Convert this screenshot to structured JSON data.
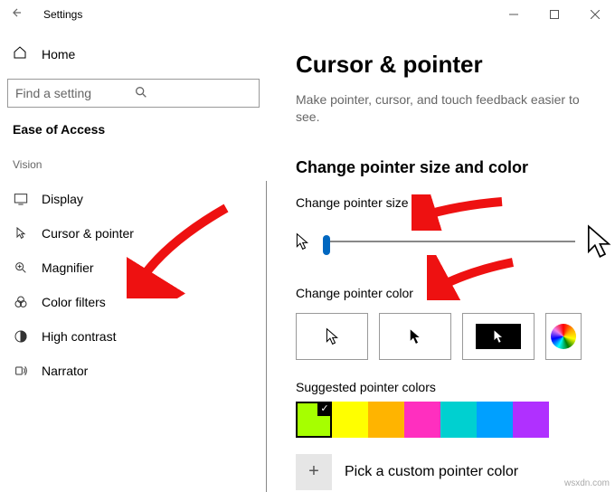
{
  "titlebar": {
    "title": "Settings"
  },
  "sidebar": {
    "home": "Home",
    "search_placeholder": "Find a setting",
    "category": "Ease of Access",
    "group": "Vision",
    "items": [
      {
        "label": "Display"
      },
      {
        "label": "Cursor & pointer"
      },
      {
        "label": "Magnifier"
      },
      {
        "label": "Color filters"
      },
      {
        "label": "High contrast"
      },
      {
        "label": "Narrator"
      }
    ]
  },
  "content": {
    "heading": "Cursor & pointer",
    "description": "Make pointer, cursor, and touch feedback easier to see.",
    "section1": "Change pointer size and color",
    "size_label": "Change pointer size",
    "color_label": "Change pointer color",
    "suggested_label": "Suggested pointer colors",
    "custom_label": "Pick a custom pointer color",
    "suggested_colors": [
      "#a6ff00",
      "#ffff00",
      "#ffb400",
      "#ff2fbf",
      "#00d0d0",
      "#00a0ff",
      "#b030ff"
    ]
  },
  "watermark": "wsxdn.com"
}
